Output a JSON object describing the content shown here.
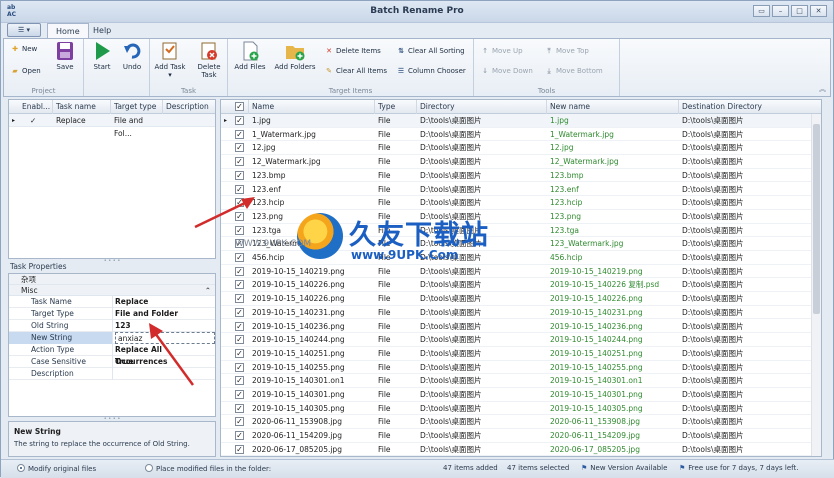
{
  "window": {
    "title": "Batch Rename Pro",
    "app_icon_text": "ab\nAC"
  },
  "ribbon_tabs": [
    {
      "label": "Home",
      "active": true
    },
    {
      "label": "Help",
      "active": false
    }
  ],
  "ribbon": {
    "project": {
      "label": "Project",
      "new": "New",
      "open": "Open",
      "save": "Save"
    },
    "task": {
      "label": "Task",
      "start": "Start",
      "undo": "Undo"
    },
    "task2": {
      "add_task": "Add Task",
      "delete_task": "Delete Task"
    },
    "target_items": {
      "label": "Target Items",
      "add_files": "Add Files",
      "add_folders": "Add Folders",
      "delete_items": "Delete Items",
      "clear_all_items": "Clear All Items",
      "clear_all_sorting": "Clear All Sorting",
      "column_chooser": "Column Chooser"
    },
    "tools": {
      "label": "Tools",
      "move_up": "Move Up",
      "move_down": "Move Down",
      "move_top": "Move Top",
      "move_bottom": "Move Bottom"
    }
  },
  "task_grid": {
    "columns": [
      "Enabl...",
      "Task name",
      "Target type",
      "Description"
    ],
    "rows": [
      {
        "enabled": "✓",
        "name": "Replace",
        "target": "File and Fol...",
        "desc": ""
      }
    ]
  },
  "task_properties": {
    "label": "Task Properties",
    "category_top": "杂项",
    "category": "Misc",
    "rows": [
      {
        "key": "Task Name",
        "value": "Replace"
      },
      {
        "key": "Target Type",
        "value": "File and Folder"
      },
      {
        "key": "Old String",
        "value": "123"
      },
      {
        "key": "New String",
        "value": "anxiaz"
      },
      {
        "key": "Action Type",
        "value": "Replace All Occurrences"
      },
      {
        "key": "Case Sensitive",
        "value": "True"
      },
      {
        "key": "Description",
        "value": ""
      }
    ],
    "desc_title": "New String",
    "desc_text": "The string to replace the occurrence of Old String."
  },
  "file_grid": {
    "columns": [
      "Name",
      "Type",
      "Directory",
      "New name",
      "Destination Directory"
    ],
    "rows": [
      {
        "name": "1.jpg",
        "type": "File",
        "dir": "D:\\tools\\桌面图片",
        "new": "1.jpg",
        "dest": "D:\\tools\\桌面图片"
      },
      {
        "name": "1_Watermark.jpg",
        "type": "File",
        "dir": "D:\\tools\\桌面图片",
        "new": "1_Watermark.jpg",
        "dest": "D:\\tools\\桌面图片"
      },
      {
        "name": "12.jpg",
        "type": "File",
        "dir": "D:\\tools\\桌面图片",
        "new": "12.jpg",
        "dest": "D:\\tools\\桌面图片"
      },
      {
        "name": "12_Watermark.jpg",
        "type": "File",
        "dir": "D:\\tools\\桌面图片",
        "new": "12_Watermark.jpg",
        "dest": "D:\\tools\\桌面图片"
      },
      {
        "name": "123.bmp",
        "type": "File",
        "dir": "D:\\tools\\桌面图片",
        "new": "123.bmp",
        "dest": "D:\\tools\\桌面图片"
      },
      {
        "name": "123.enf",
        "type": "File",
        "dir": "D:\\tools\\桌面图片",
        "new": "123.enf",
        "dest": "D:\\tools\\桌面图片"
      },
      {
        "name": "123.hcip",
        "type": "File",
        "dir": "D:\\tools\\桌面图片",
        "new": "123.hcip",
        "dest": "D:\\tools\\桌面图片"
      },
      {
        "name": "123.png",
        "type": "File",
        "dir": "D:\\tools\\桌面图片",
        "new": "123.png",
        "dest": "D:\\tools\\桌面图片"
      },
      {
        "name": "123.tga",
        "type": "File",
        "dir": "D:\\tools\\桌面图片",
        "new": "123.tga",
        "dest": "D:\\tools\\桌面图片"
      },
      {
        "name": "123_Waterma...",
        "type": "File",
        "dir": "D:\\tools\\桌面图片",
        "new": "123_Watermark.jpg",
        "dest": "D:\\tools\\桌面图片"
      },
      {
        "name": "456.hcip",
        "type": "File",
        "dir": "D:\\tools\\桌面图片",
        "new": "456.hcip",
        "dest": "D:\\tools\\桌面图片"
      },
      {
        "name": "2019-10-15_140219.png",
        "type": "File",
        "dir": "D:\\tools\\桌面图片",
        "new": "2019-10-15_140219.png",
        "dest": "D:\\tools\\桌面图片"
      },
      {
        "name": "2019-10-15_140226.png",
        "type": "File",
        "dir": "D:\\tools\\桌面图片",
        "new": "2019-10-15_140226 复制.psd",
        "dest": "D:\\tools\\桌面图片"
      },
      {
        "name": "2019-10-15_140226.png",
        "type": "File",
        "dir": "D:\\tools\\桌面图片",
        "new": "2019-10-15_140226.png",
        "dest": "D:\\tools\\桌面图片"
      },
      {
        "name": "2019-10-15_140231.png",
        "type": "File",
        "dir": "D:\\tools\\桌面图片",
        "new": "2019-10-15_140231.png",
        "dest": "D:\\tools\\桌面图片"
      },
      {
        "name": "2019-10-15_140236.png",
        "type": "File",
        "dir": "D:\\tools\\桌面图片",
        "new": "2019-10-15_140236.png",
        "dest": "D:\\tools\\桌面图片"
      },
      {
        "name": "2019-10-15_140244.png",
        "type": "File",
        "dir": "D:\\tools\\桌面图片",
        "new": "2019-10-15_140244.png",
        "dest": "D:\\tools\\桌面图片"
      },
      {
        "name": "2019-10-15_140251.png",
        "type": "File",
        "dir": "D:\\tools\\桌面图片",
        "new": "2019-10-15_140251.png",
        "dest": "D:\\tools\\桌面图片"
      },
      {
        "name": "2019-10-15_140255.png",
        "type": "File",
        "dir": "D:\\tools\\桌面图片",
        "new": "2019-10-15_140255.png",
        "dest": "D:\\tools\\桌面图片"
      },
      {
        "name": "2019-10-15_140301.on1",
        "type": "File",
        "dir": "D:\\tools\\桌面图片",
        "new": "2019-10-15_140301.on1",
        "dest": "D:\\tools\\桌面图片"
      },
      {
        "name": "2019-10-15_140301.png",
        "type": "File",
        "dir": "D:\\tools\\桌面图片",
        "new": "2019-10-15_140301.png",
        "dest": "D:\\tools\\桌面图片"
      },
      {
        "name": "2019-10-15_140305.png",
        "type": "File",
        "dir": "D:\\tools\\桌面图片",
        "new": "2019-10-15_140305.png",
        "dest": "D:\\tools\\桌面图片"
      },
      {
        "name": "2020-06-11_153908.jpg",
        "type": "File",
        "dir": "D:\\tools\\桌面图片",
        "new": "2020-06-11_153908.jpg",
        "dest": "D:\\tools\\桌面图片"
      },
      {
        "name": "2020-06-11_154209.jpg",
        "type": "File",
        "dir": "D:\\tools\\桌面图片",
        "new": "2020-06-11_154209.jpg",
        "dest": "D:\\tools\\桌面图片"
      },
      {
        "name": "2020-06-17_085205.jpg",
        "type": "File",
        "dir": "D:\\tools\\桌面图片",
        "new": "2020-06-17_085205.jpg",
        "dest": "D:\\tools\\桌面图片"
      }
    ]
  },
  "status": {
    "modify_original": "Modify original files",
    "place_modified": "Place modified files in the folder:",
    "items_added": "47 items added",
    "items_selected": "47 items selected",
    "new_version": "New Version Available",
    "free_use": "Free use for 7 days, 7 days left."
  },
  "watermark": {
    "cn": "久友下载站",
    "url": "www.9UPK.Com",
    "side": "WWW.9UPK.COM"
  },
  "colors": {
    "new_name": "#2f8a2f",
    "accent": "#1b5fc2",
    "arrow": "#d22b2b"
  }
}
